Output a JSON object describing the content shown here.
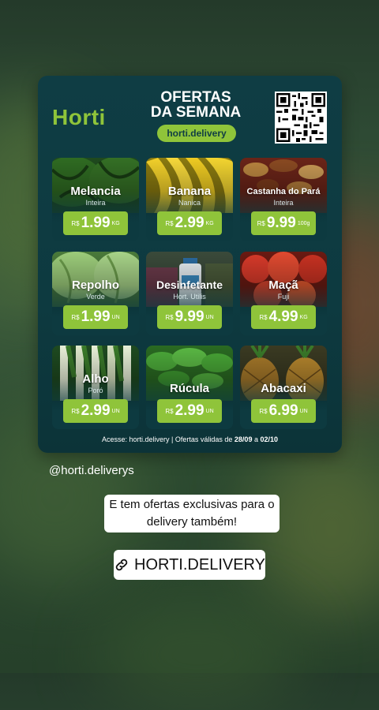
{
  "flyer": {
    "brand": "Horti",
    "title_line1": "OFERTAS",
    "title_line2": "DA SEMANA",
    "site": "horti.delivery",
    "products": [
      {
        "name": "Melancia",
        "sub": "Inteira",
        "currency": "R$",
        "price": "1.99",
        "unit": "KG"
      },
      {
        "name": "Banana",
        "sub": "Nanica",
        "currency": "R$",
        "price": "2.99",
        "unit": "KG"
      },
      {
        "name": "Castanha do Pará",
        "sub": "Inteira",
        "currency": "R$",
        "price": "9.99",
        "unit": "100g"
      },
      {
        "name": "Repolho",
        "sub": "Verde",
        "currency": "R$",
        "price": "1.99",
        "unit": "UN"
      },
      {
        "name": "Desinfetante",
        "sub": "Hort. Utilis",
        "currency": "R$",
        "price": "9.99",
        "unit": "UN"
      },
      {
        "name": "Maçã",
        "sub": "Fuji",
        "currency": "R$",
        "price": "4.99",
        "unit": "KG"
      },
      {
        "name": "Alho",
        "sub": "Poró",
        "currency": "R$",
        "price": "2.99",
        "unit": "UN"
      },
      {
        "name": "Rúcula",
        "sub": "",
        "currency": "R$",
        "price": "2.99",
        "unit": "UN"
      },
      {
        "name": "Abacaxi",
        "sub": "",
        "currency": "R$",
        "price": "6.99",
        "unit": "UN"
      }
    ],
    "footer_prefix": "Acesse: horti.delivery | Ofertas válidas de ",
    "footer_from": "28/09",
    "footer_mid": " a ",
    "footer_to": "02/10",
    "colors": {
      "accent": "#8fc43a",
      "panel": "#0f3d44"
    }
  },
  "story": {
    "mention": "@horti.deliverys",
    "caption_line1": "E tem ofertas exclusivas para o",
    "caption_line2": "delivery também!",
    "link_label": "HORTI.DELIVERY",
    "link_icon": "link-icon"
  }
}
